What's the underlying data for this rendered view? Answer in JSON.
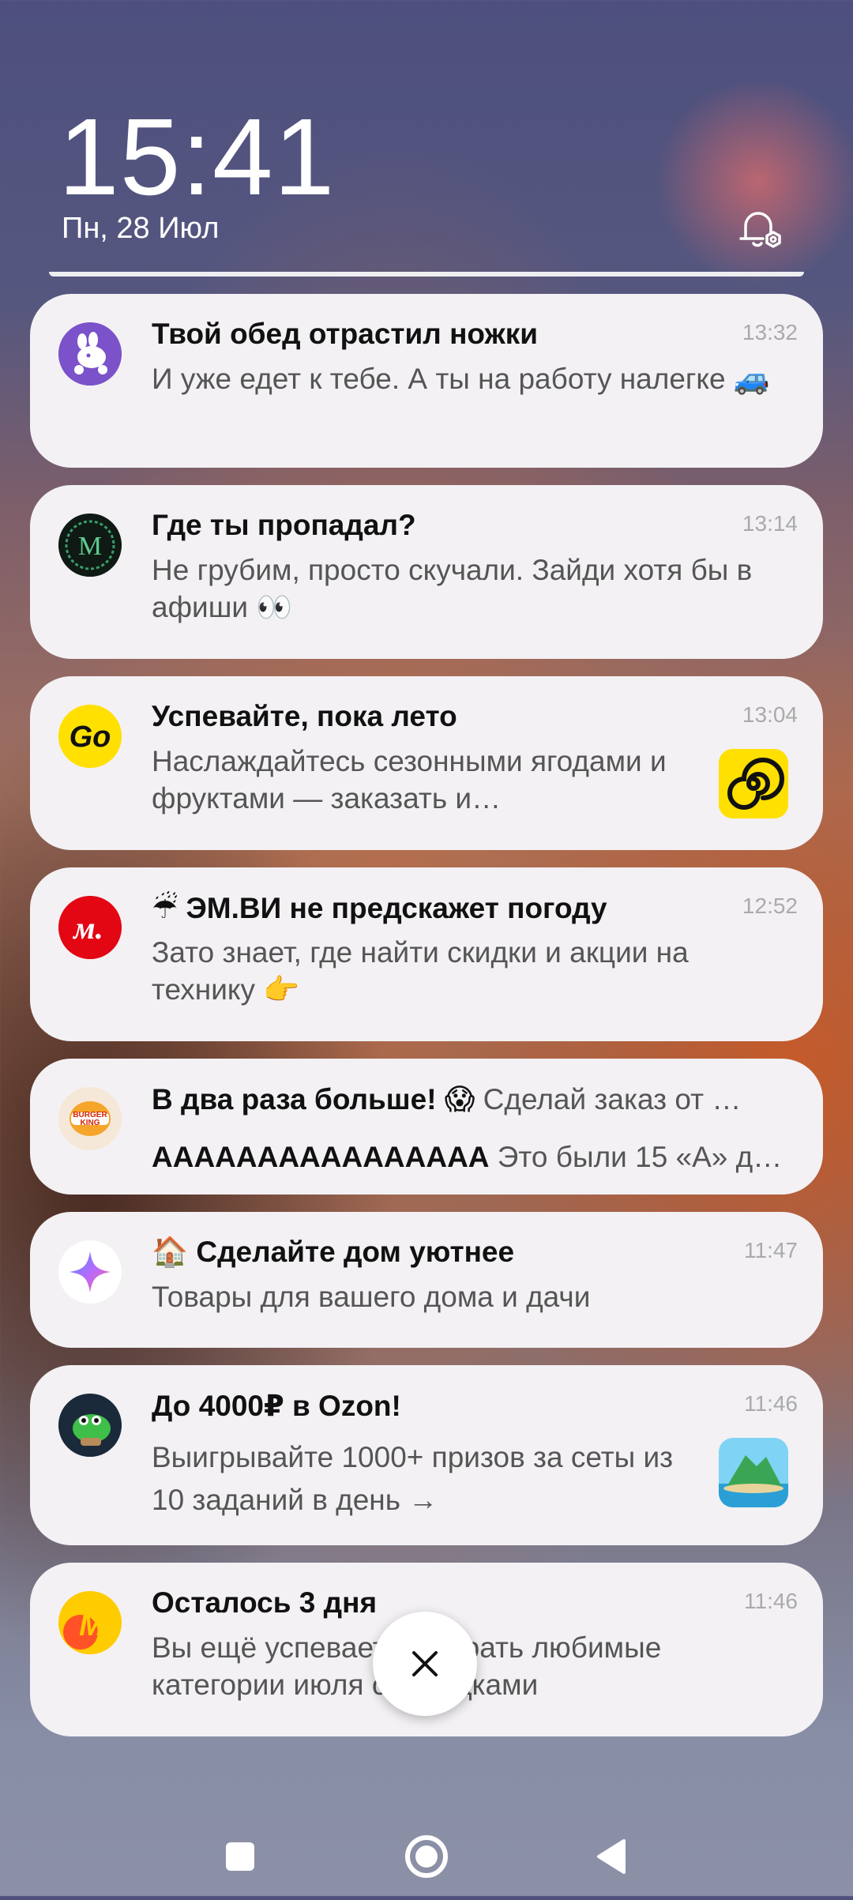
{
  "lockscreen": {
    "time": "15:41",
    "date": "Пн, 28 Июл",
    "bell_icon": "bell-settings-icon"
  },
  "notifications": [
    {
      "title": "Твой обед отрастил ножки",
      "body": "И уже едет к тебе. А ты на работу налегке 🚙",
      "time": "13:32",
      "icon": "delivery-rabbit-icon"
    },
    {
      "title": "Где ты пропадал?",
      "body": "Не грубим, просто скучали. Зайди хотя бы в афиши 👀",
      "time": "13:14",
      "icon": "m-green-ornament-icon"
    },
    {
      "title": "Успевайте, пока лето",
      "body": "Наслаждайтесь сезонными ягодами и фруктами — заказать и…",
      "time": "13:04",
      "icon": "go-yellow-icon"
    },
    {
      "title": "☔ ЭМ.ВИ не предскажет погоду",
      "body": "Зато знает, где найти скидки и акции на технику 👉",
      "time": "12:52",
      "icon": "mvideo-icon"
    },
    {
      "title": "В два раза больше! 😱",
      "title_extra": " Сделай заказ от …",
      "line2_bold": "АААААААААААААААА",
      "line2_rest": " Это были 15 «А» д…",
      "icon": "burger-king-icon"
    },
    {
      "title": "🏠 Сделайте дом уютнее",
      "body": "Товары для вашего дома и дачи",
      "time": "11:47",
      "icon": "sparkle-star-icon"
    },
    {
      "title": "До 4000₽ в Ozon!",
      "body": "Выигрывайте 1000+ призов за сеты из 10 заданий в день →",
      "time": "11:46",
      "icon": "dinosaur-icon"
    },
    {
      "title": "Осталось 3 дня",
      "body": "Вы ещё успеваете выбрать любимые категории июля со скидками",
      "time": "11:46",
      "icon": "yandex-market-icon"
    }
  ],
  "colors": {
    "card": "#f3f1f4",
    "mvideo": "#e30613",
    "go": "#ffe000"
  }
}
